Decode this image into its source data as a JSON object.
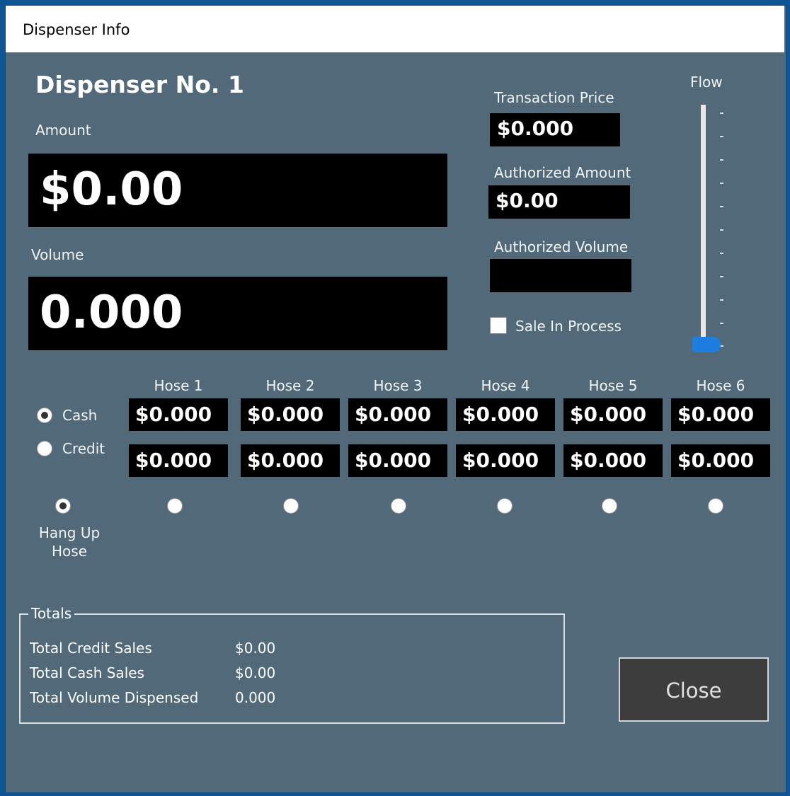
{
  "window": {
    "title": "Dispenser Info"
  },
  "dispenser": {
    "heading": "Dispenser No. 1"
  },
  "amount": {
    "label": "Amount",
    "value": "$0.00"
  },
  "volume": {
    "label": "Volume",
    "value": "0.000"
  },
  "transaction_price": {
    "label": "Transaction Price",
    "value": "$0.000"
  },
  "authorized_amount": {
    "label": "Authorized Amount",
    "value": "$0.00"
  },
  "authorized_volume": {
    "label": "Authorized Volume",
    "value": ""
  },
  "sale_in_process": {
    "label": "Sale In Process",
    "checked": false
  },
  "flow": {
    "label": "Flow",
    "level": 0
  },
  "payment": {
    "cash_label": "Cash",
    "credit_label": "Credit",
    "selected": "cash"
  },
  "hang_up": {
    "label_line1": "Hang Up",
    "label_line2": "Hose",
    "selected": true
  },
  "hoses": [
    {
      "label": "Hose 1",
      "cash": "$0.000",
      "credit": "$0.000"
    },
    {
      "label": "Hose 2",
      "cash": "$0.000",
      "credit": "$0.000"
    },
    {
      "label": "Hose 3",
      "cash": "$0.000",
      "credit": "$0.000"
    },
    {
      "label": "Hose 4",
      "cash": "$0.000",
      "credit": "$0.000"
    },
    {
      "label": "Hose 5",
      "cash": "$0.000",
      "credit": "$0.000"
    },
    {
      "label": "Hose 6",
      "cash": "$0.000",
      "credit": "$0.000"
    }
  ],
  "totals": {
    "legend": "Totals",
    "credit_label": "Total Credit Sales",
    "credit_value": "$0.00",
    "cash_label": "Total Cash Sales",
    "cash_value": "$0.00",
    "volume_label": "Total Volume Dispensed",
    "volume_value": "0.000"
  },
  "close_button": "Close",
  "colors": {
    "background": "#516978",
    "accent": "#1e7ee0",
    "display": "#000000"
  }
}
